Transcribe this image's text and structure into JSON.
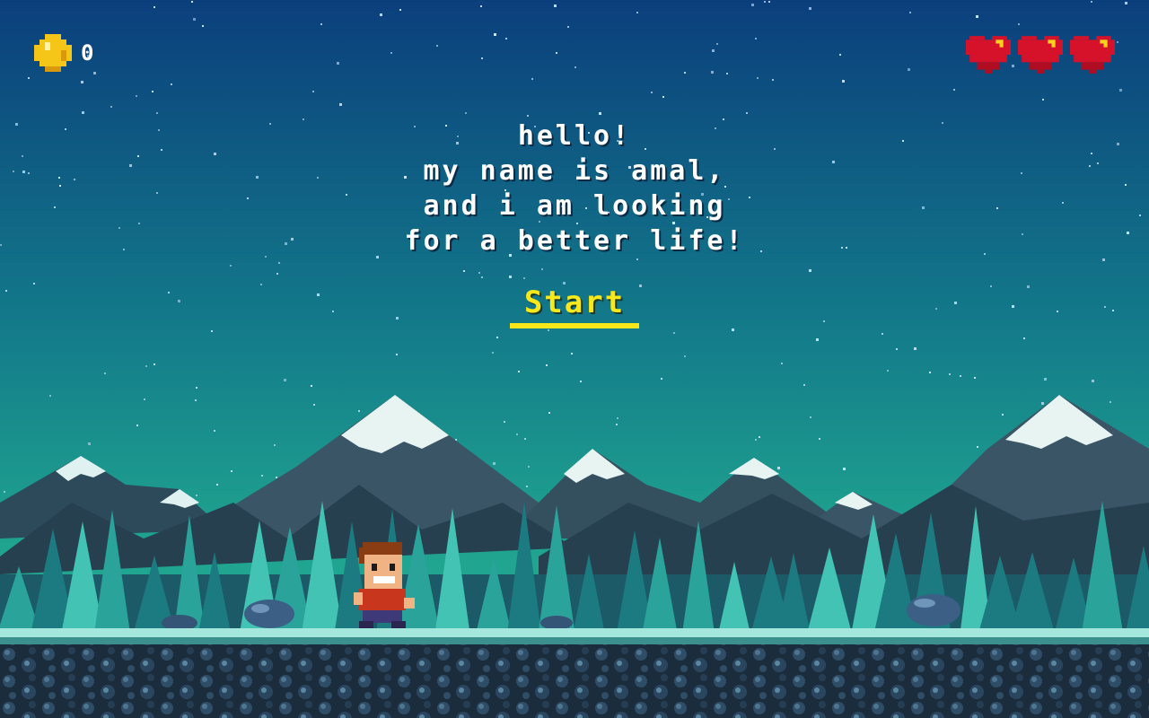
{
  "hud": {
    "coin_count": "0",
    "hearts": [
      "heart",
      "heart",
      "heart"
    ]
  },
  "intro": {
    "lines": [
      "Hello!",
      "My name is Amal,",
      "and I am looking",
      "for a better life!"
    ]
  },
  "start_label": "Start",
  "colors": {
    "sky_top": "#0b3f7c",
    "sky_bottom": "#1fa38f",
    "start": "#f6e81a",
    "heart": "#d6112a",
    "coin": "#f5c518"
  }
}
